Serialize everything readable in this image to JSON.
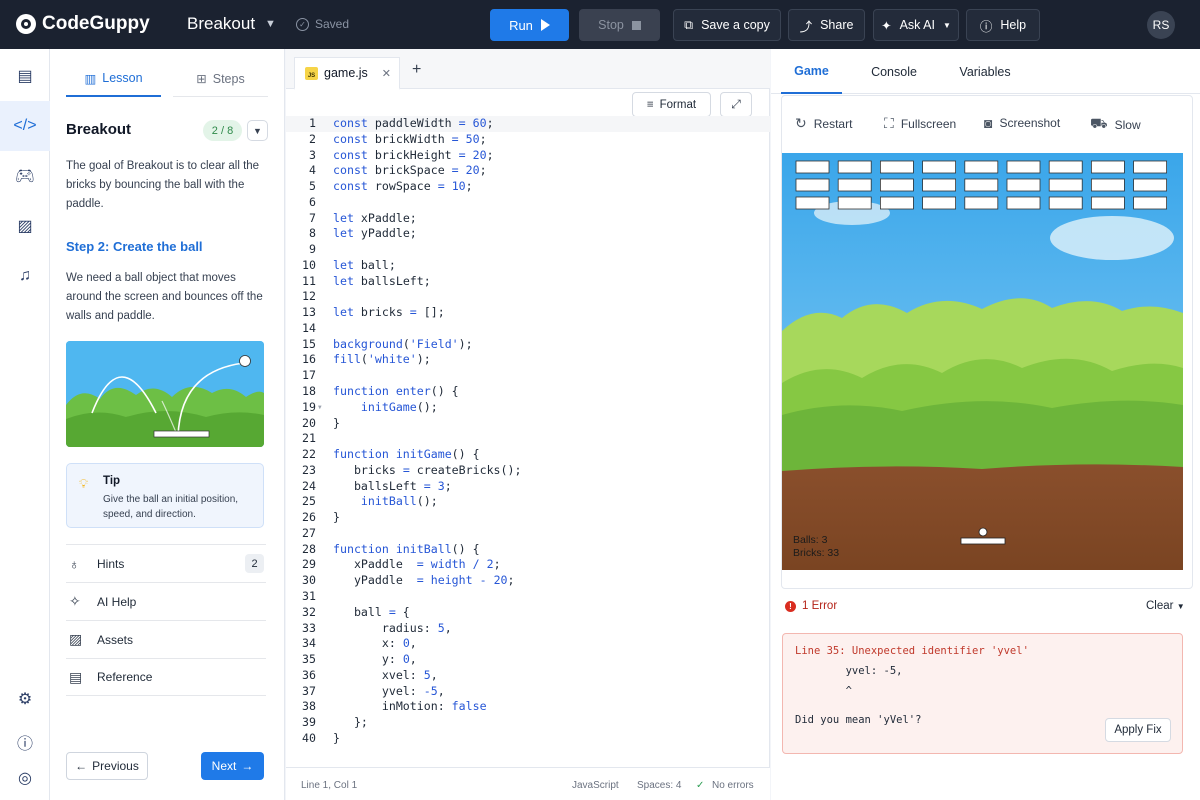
{
  "app": {
    "logo": "CodeGuppy",
    "project_name": "Breakout",
    "saved_label": "Saved"
  },
  "toolbar": {
    "run": "Run",
    "stop": "Stop",
    "save_copy": "Save a copy",
    "share": "Share",
    "ask_ai": "Ask AI",
    "help": "Help",
    "avatar": "RS"
  },
  "lesson": {
    "tabs": [
      "Lesson",
      "Steps"
    ],
    "title": "Breakout",
    "progress": "2 / 8",
    "intro": "The goal of Breakout is to clear all the bricks by bouncing the ball with the paddle.",
    "step_title": "Step 2: Create the ball",
    "step_body": "We need a ball object that moves around the screen and bounces off the walls and paddle.",
    "tip_title": "Tip",
    "tip_body": "Give the ball an initial position, speed, and direction.",
    "rows": [
      {
        "label": "Hints",
        "badge": "2"
      },
      {
        "label": "AI Help"
      },
      {
        "label": "Assets"
      },
      {
        "label": "Reference"
      }
    ],
    "prev": "Previous",
    "next": "Next"
  },
  "editor": {
    "file_tab": "game.js",
    "format": "Format",
    "lines": [
      "const paddleWidth = 60;",
      "const brickWidth = 50;",
      "const brickHeight = 20;",
      "const brickSpace = 20;",
      "const rowSpace = 10;",
      "",
      "let xPaddle;",
      "let yPaddle;",
      "",
      "let ball;",
      "let ballsLeft;",
      "",
      "let bricks = [];",
      "",
      "background('Field');",
      "fill('white');",
      "",
      "function enter() {",
      "    initGame();",
      "}",
      "",
      "function initGame() {",
      "   bricks = createBricks();",
      "   ballsLeft = 3;",
      "    initBall();",
      "}",
      "",
      "function initBall() {",
      "   xPaddle  = width / 2;",
      "   yPaddle  = height - 20;",
      "",
      "   ball = {",
      "       radius: 5,",
      "       x: 0,",
      "       y: 0,",
      "       xvel: 5,",
      "       yvel: -5,",
      "       inMotion: false",
      "   };",
      "}"
    ],
    "status": {
      "position": "Line 1, Col 1",
      "language": "JavaScript",
      "spaces": "Spaces: 4",
      "errors": "No errors"
    }
  },
  "right": {
    "tabs": [
      "Game",
      "Console",
      "Variables"
    ],
    "tools": [
      "Restart",
      "Fullscreen",
      "Screenshot",
      "Slow"
    ],
    "hud": {
      "balls": "Balls: 3",
      "bricks": "Bricks: 33"
    },
    "error_count": "1 Error",
    "clear": "Clear",
    "error_lines": [
      "Line 35: Unexpected identifier 'yvel'",
      "        yvel: -5,",
      "        ^",
      "",
      "Did you mean 'yVel'?"
    ],
    "apply_fix": "Apply Fix"
  }
}
